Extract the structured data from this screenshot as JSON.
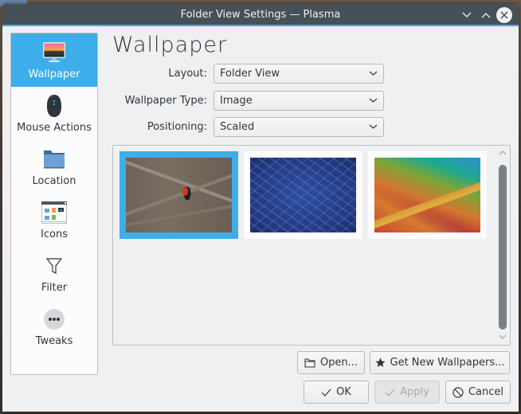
{
  "window": {
    "title": "Folder View Settings — Plasma",
    "controls": {
      "minimize_icon": "chevron-down-icon",
      "maximize_icon": "chevron-up-icon",
      "close_icon": "close-icon"
    }
  },
  "sidebar": {
    "items": [
      {
        "label": "Wallpaper",
        "icon": "monitor-wallpaper-icon",
        "active": true
      },
      {
        "label": "Mouse Actions",
        "icon": "mouse-icon",
        "active": false
      },
      {
        "label": "Location",
        "icon": "folder-icon",
        "active": false
      },
      {
        "label": "Icons",
        "icon": "icons-view-icon",
        "active": false
      },
      {
        "label": "Filter",
        "icon": "filter-icon",
        "active": false
      },
      {
        "label": "Tweaks",
        "icon": "more-icon",
        "active": false
      }
    ]
  },
  "main": {
    "title": "Wallpaper",
    "form": {
      "layout": {
        "label": "Layout:",
        "value": "Folder View"
      },
      "wallpaper_type": {
        "label": "Wallpaper Type:",
        "value": "Image"
      },
      "positioning": {
        "label": "Positioning:",
        "value": "Scaled"
      }
    },
    "wallpapers": [
      {
        "name": "bird-on-branch",
        "selected": true
      },
      {
        "name": "blue-texture",
        "selected": false
      },
      {
        "name": "kde-polygons",
        "selected": false
      }
    ],
    "buttons": {
      "open": "Open...",
      "get_new": "Get New Wallpapers..."
    }
  },
  "footer": {
    "ok": "OK",
    "apply": "Apply",
    "cancel": "Cancel"
  },
  "colors": {
    "accent": "#3daee9",
    "titlebar": "#475057",
    "background": "#eff0f1"
  }
}
